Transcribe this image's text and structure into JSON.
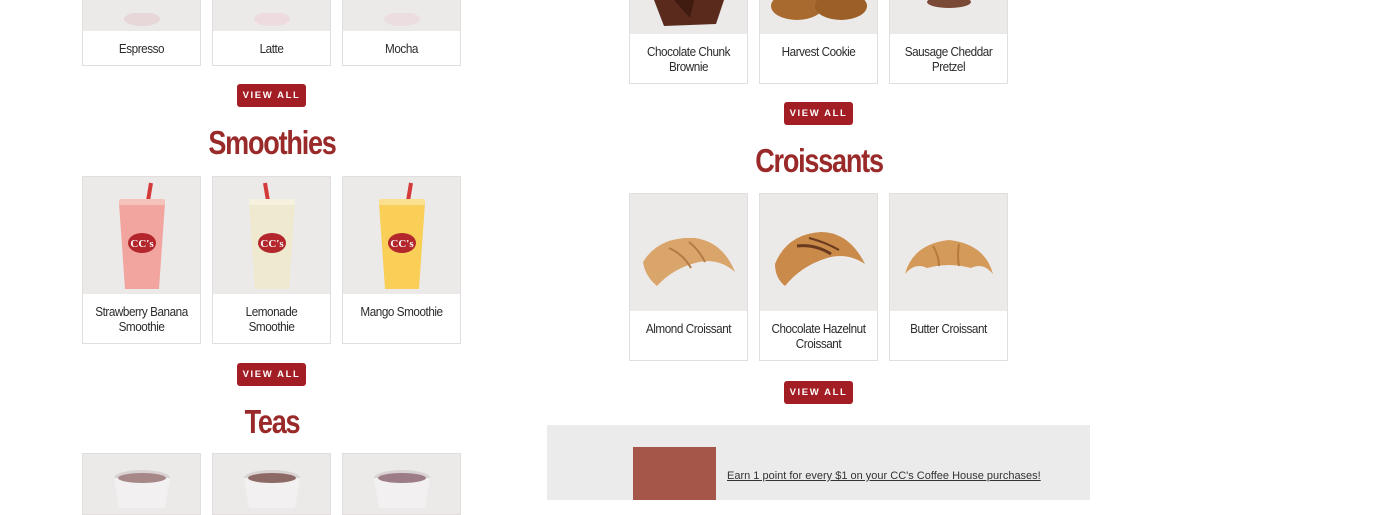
{
  "left": {
    "coffee_items": [
      "Espresso",
      "Latte",
      "Mocha"
    ],
    "smoothies_title": "Smoothies",
    "smoothie_items": [
      "Strawberry Banana Smoothie",
      "Lemonade Smoothie",
      "Mango Smoothie"
    ],
    "teas_title": "Teas"
  },
  "right": {
    "bakery_items": [
      "Chocolate Chunk Brownie",
      "Harvest Cookie",
      "Sausage Cheddar Pretzel"
    ],
    "croissants_title": "Croissants",
    "croissant_items": [
      "Almond Croissant",
      "Chocolate Hazelnut Croissant",
      "Butter Croissant"
    ]
  },
  "view_all_label": "VIEW ALL",
  "promo": {
    "text": "Earn 1 point for every $1 on your CC's Coffee House purchases!"
  },
  "colors": {
    "accent": "#a31d24",
    "heading": "#9a2a2a",
    "promo_bg": "#ecebeb",
    "promo_square": "#a65549"
  }
}
